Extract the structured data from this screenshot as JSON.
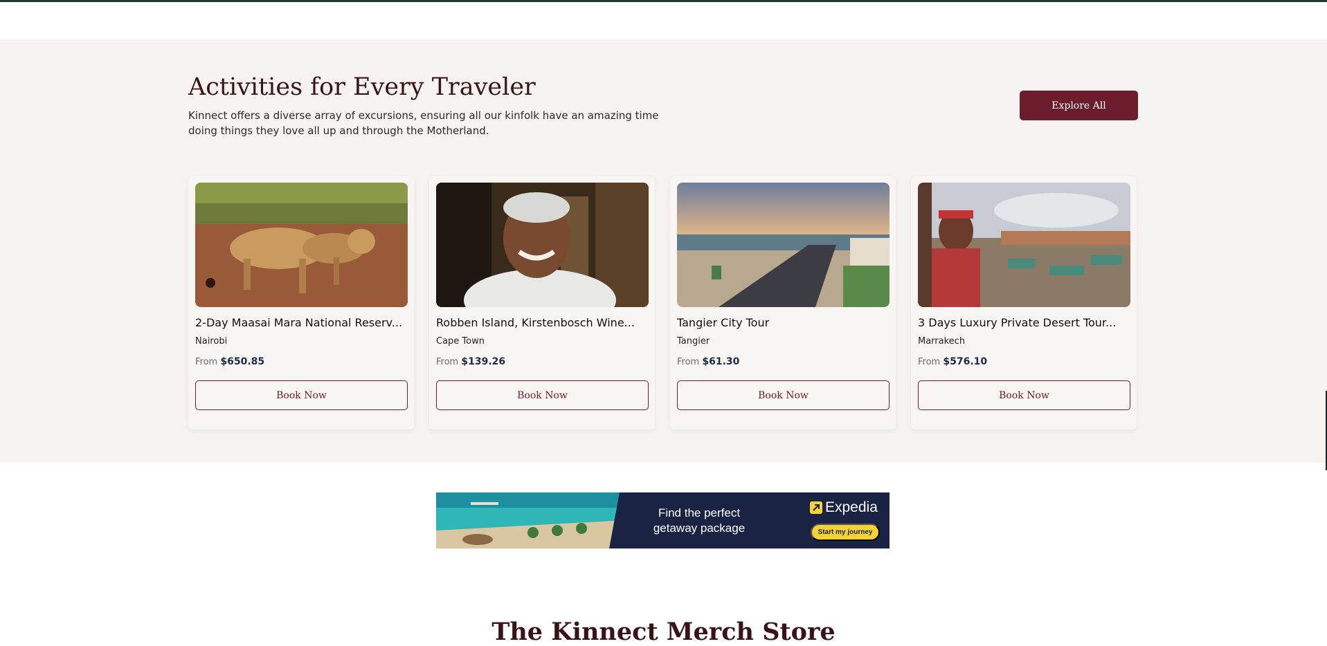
{
  "section": {
    "heading": "Activities for Every Traveler",
    "subtext": "Kinnect offers a diverse array of excursions, ensuring all our kinfolk have an amazing time doing things they love all up and through the Motherland.",
    "explore_label": "Explore All"
  },
  "cards": [
    {
      "title": "2-Day Maasai Mara National Reserv...",
      "location": "Nairobi",
      "from_label": "From",
      "price": "$650.85",
      "book_label": "Book Now",
      "image": "lions-photo"
    },
    {
      "title": "Robben Island, Kirstenbosch Wine...",
      "location": "Cape Town",
      "from_label": "From",
      "price": "$139.26",
      "book_label": "Book Now",
      "image": "portrait-photo"
    },
    {
      "title": "Tangier City Tour",
      "location": "Tangier",
      "from_label": "From",
      "price": "$61.30",
      "book_label": "Book Now",
      "image": "city-coast-photo"
    },
    {
      "title": "3 Days Luxury Private Desert Tour...",
      "location": "Marrakech",
      "from_label": "From",
      "price": "$576.10",
      "book_label": "Book Now",
      "image": "market-square-photo"
    }
  ],
  "ad": {
    "text": "Find the perfect getaway package",
    "brand": "Expedia",
    "cta": "Start my journey",
    "image": "beach-resort-photo"
  },
  "merch": {
    "heading": "The Kinnect Merch Store"
  },
  "colors": {
    "accent": "#6b1d2c",
    "heading": "#3a1218",
    "section_bg": "#f7f3f0",
    "price": "#1c2c4a",
    "ad_bg": "#1b2344",
    "ad_yellow": "#f6d335"
  }
}
